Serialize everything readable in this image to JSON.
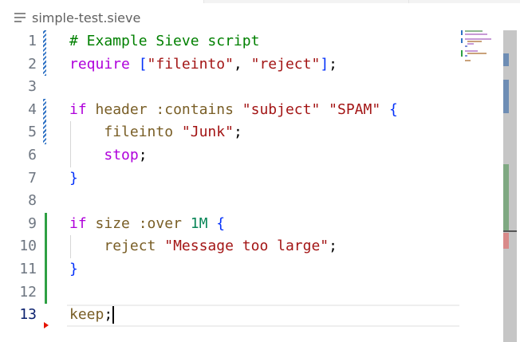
{
  "breadcrumb": {
    "icon": "file-lines-icon",
    "filename": "simple-test.sieve"
  },
  "editor": {
    "active_line": 13,
    "lines": [
      {
        "number": "1",
        "tokens": [
          {
            "c": "t-comment",
            "t": "# Example Sieve script"
          }
        ]
      },
      {
        "number": "2",
        "tokens": [
          {
            "c": "t-keyword",
            "t": "require"
          },
          {
            "c": "t-punct",
            "t": " "
          },
          {
            "c": "t-bracket",
            "t": "["
          },
          {
            "c": "t-string",
            "t": "\"fileinto\""
          },
          {
            "c": "t-punct",
            "t": ", "
          },
          {
            "c": "t-string",
            "t": "\"reject\""
          },
          {
            "c": "t-bracket",
            "t": "]"
          },
          {
            "c": "t-punct",
            "t": ";"
          }
        ]
      },
      {
        "number": "3",
        "tokens": []
      },
      {
        "number": "4",
        "tokens": [
          {
            "c": "t-keyword",
            "t": "if"
          },
          {
            "c": "t-punct",
            "t": " "
          },
          {
            "c": "t-plain",
            "t": "header :contains"
          },
          {
            "c": "t-punct",
            "t": " "
          },
          {
            "c": "t-string",
            "t": "\"subject\""
          },
          {
            "c": "t-punct",
            "t": " "
          },
          {
            "c": "t-string",
            "t": "\"SPAM\""
          },
          {
            "c": "t-punct",
            "t": " "
          },
          {
            "c": "t-bracket",
            "t": "{"
          }
        ]
      },
      {
        "number": "5",
        "tokens": [
          {
            "c": "t-punct",
            "t": "    "
          },
          {
            "c": "t-plain",
            "t": "fileinto"
          },
          {
            "c": "t-punct",
            "t": " "
          },
          {
            "c": "t-string",
            "t": "\"Junk\""
          },
          {
            "c": "t-punct",
            "t": ";"
          }
        ]
      },
      {
        "number": "6",
        "tokens": [
          {
            "c": "t-punct",
            "t": "    "
          },
          {
            "c": "t-keyword",
            "t": "stop"
          },
          {
            "c": "t-punct",
            "t": ";"
          }
        ]
      },
      {
        "number": "7",
        "tokens": [
          {
            "c": "t-bracket",
            "t": "}"
          }
        ]
      },
      {
        "number": "8",
        "tokens": []
      },
      {
        "number": "9",
        "tokens": [
          {
            "c": "t-keyword",
            "t": "if"
          },
          {
            "c": "t-punct",
            "t": " "
          },
          {
            "c": "t-plain",
            "t": "size :over"
          },
          {
            "c": "t-punct",
            "t": " "
          },
          {
            "c": "t-num",
            "t": "1M"
          },
          {
            "c": "t-punct",
            "t": " "
          },
          {
            "c": "t-bracket",
            "t": "{"
          }
        ]
      },
      {
        "number": "10",
        "tokens": [
          {
            "c": "t-punct",
            "t": "    "
          },
          {
            "c": "t-plain",
            "t": "reject"
          },
          {
            "c": "t-punct",
            "t": " "
          },
          {
            "c": "t-string",
            "t": "\"Message too large\""
          },
          {
            "c": "t-punct",
            "t": ";"
          }
        ]
      },
      {
        "number": "11",
        "tokens": [
          {
            "c": "t-bracket",
            "t": "}"
          }
        ]
      },
      {
        "number": "12",
        "tokens": []
      },
      {
        "number": "13",
        "tokens": [
          {
            "c": "t-plain",
            "t": "keep"
          },
          {
            "c": "t-punct",
            "t": ";"
          }
        ]
      }
    ],
    "git_decorations": [
      {
        "line": 1,
        "kind": "modified"
      },
      {
        "line": 2,
        "kind": "modified"
      },
      {
        "line": 4,
        "kind": "modified"
      },
      {
        "line": 5,
        "kind": "modified"
      },
      {
        "line": 9,
        "kind": "added"
      },
      {
        "line": 10,
        "kind": "added"
      },
      {
        "line": 11,
        "kind": "added"
      },
      {
        "line": 12,
        "kind": "added"
      }
    ],
    "deleted_marker_line": 13
  },
  "colors": {
    "modified": "#2f72c4",
    "added": "#2ea043",
    "deleted": "#e51400",
    "active_line_number": "#0b216f"
  }
}
